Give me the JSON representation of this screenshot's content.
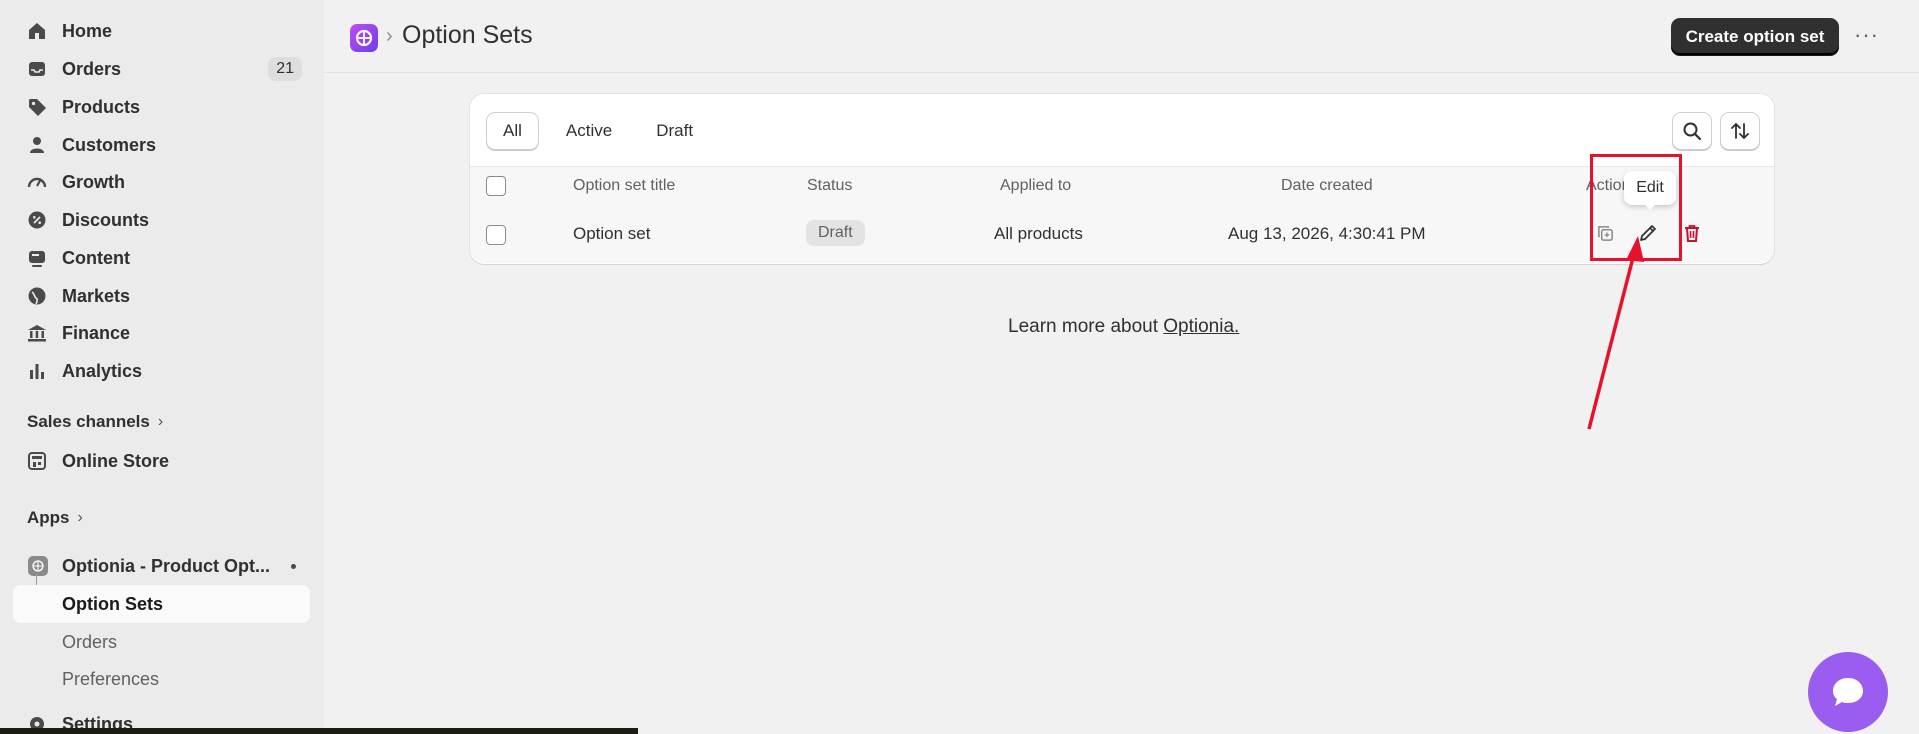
{
  "sidebar": {
    "nav": [
      {
        "label": "Home",
        "icon": "home-icon"
      },
      {
        "label": "Orders",
        "icon": "inbox-icon",
        "count": "21"
      },
      {
        "label": "Products",
        "icon": "tag-icon"
      },
      {
        "label": "Customers",
        "icon": "person-icon"
      },
      {
        "label": "Growth",
        "icon": "gauge-icon"
      },
      {
        "label": "Discounts",
        "icon": "discount-icon"
      },
      {
        "label": "Content",
        "icon": "content-icon"
      },
      {
        "label": "Markets",
        "icon": "globe-icon"
      },
      {
        "label": "Finance",
        "icon": "bank-icon"
      },
      {
        "label": "Analytics",
        "icon": "bar-chart-icon"
      }
    ],
    "sales_channels": {
      "label": "Sales channels",
      "chevron": "›"
    },
    "online_store": {
      "label": "Online Store",
      "icon": "store-icon"
    },
    "apps": {
      "label": "Apps",
      "chevron": "›"
    },
    "app": {
      "label": "Optionia - Product Opt...",
      "icon": "optionia-app-icon"
    },
    "sub_items": [
      {
        "label": "Option Sets",
        "active": true
      },
      {
        "label": "Orders",
        "active": false
      },
      {
        "label": "Preferences",
        "active": false
      }
    ],
    "settings": {
      "label": "Settings",
      "icon": "gear-icon"
    }
  },
  "header": {
    "breadcrumb_sep": "›",
    "title": "Option Sets",
    "primary_button": "Create option set",
    "more": "···"
  },
  "filters": {
    "tabs": [
      "All",
      "Active",
      "Draft"
    ],
    "selected": "All"
  },
  "table": {
    "columns": [
      "Option set title",
      "Status",
      "Applied to",
      "Date created",
      "Actions"
    ],
    "rows": [
      {
        "title": "Option set",
        "status": "Draft",
        "applied_to": "All products",
        "date_created": "Aug 13, 2026, 4:30:41 PM"
      }
    ]
  },
  "tooltip": "Edit",
  "footer": {
    "text": "Learn more about ",
    "link": "Optionia."
  },
  "colors": {
    "accent": "#303030",
    "delete": "#c41230",
    "annotation": "#e8102a",
    "chat": "#9b5df0"
  }
}
